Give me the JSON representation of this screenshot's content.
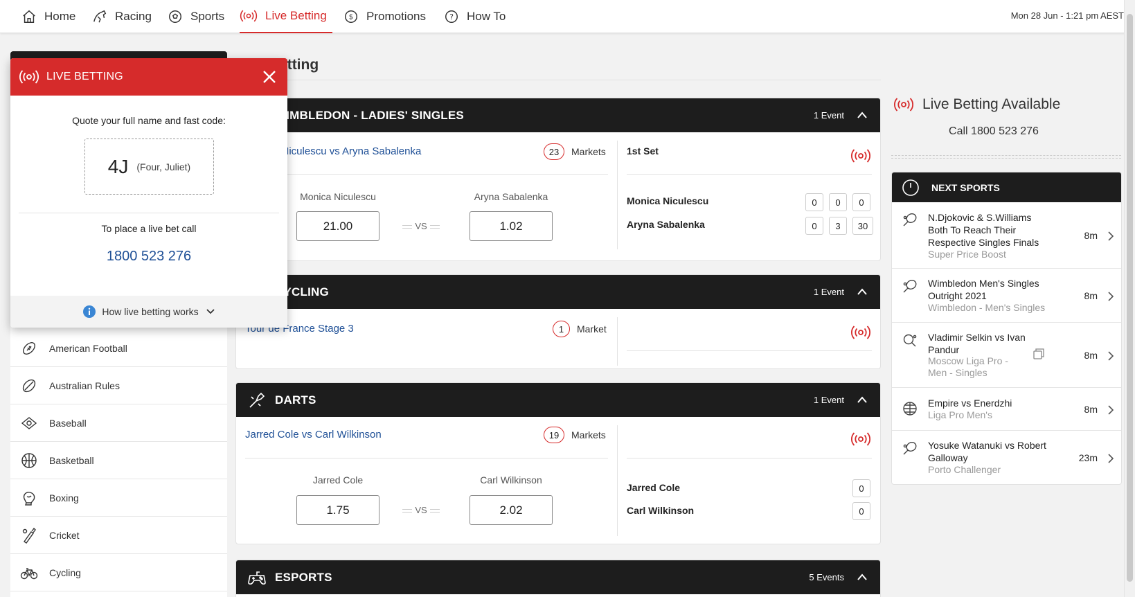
{
  "nav": {
    "items": [
      {
        "label": "Home",
        "icon": "home-icon"
      },
      {
        "label": "Racing",
        "icon": "horse-icon"
      },
      {
        "label": "Sports",
        "icon": "soccer-ball-icon"
      },
      {
        "label": "Live Betting",
        "icon": "live-signal-icon",
        "active": true
      },
      {
        "label": "Promotions",
        "icon": "dollar-coin-icon"
      },
      {
        "label": "How To",
        "icon": "help-icon"
      }
    ],
    "datetime": "Mon 28 Jun - 1:21 pm AEST"
  },
  "colors": {
    "brand_red": "#d62b2b",
    "header_dark": "#1d1d1d",
    "link_blue": "#1e4f96"
  },
  "sidebar": {
    "sports": [
      {
        "label": "American Football",
        "icon": "american-football-icon"
      },
      {
        "label": "Australian Rules",
        "icon": "australian-rules-icon"
      },
      {
        "label": "Baseball",
        "icon": "baseball-icon"
      },
      {
        "label": "Basketball",
        "icon": "basketball-icon"
      },
      {
        "label": "Boxing",
        "icon": "boxing-glove-icon"
      },
      {
        "label": "Cricket",
        "icon": "cricket-icon"
      },
      {
        "label": "Cycling",
        "icon": "bicycle-icon"
      }
    ]
  },
  "main": {
    "page_title": "Live Betting",
    "sections": [
      {
        "title": "WIMBLEDON - LADIES' SINGLES",
        "count": "1 Event",
        "event": {
          "name": "Monica Niculescu vs Aryna Sabalenka",
          "markets_count": "23",
          "markets_label": "Markets",
          "home": {
            "name": "Monica Niculescu",
            "odds": "21.00"
          },
          "away": {
            "name": "Aryna Sabalenka",
            "odds": "1.02"
          },
          "vs": "VS",
          "set_label": "1st Set",
          "scoreboard": [
            {
              "name": "Monica Niculescu",
              "scores": [
                "0",
                "0",
                "0"
              ]
            },
            {
              "name": "Aryna Sabalenka",
              "scores": [
                "0",
                "3",
                "30"
              ]
            }
          ]
        }
      },
      {
        "title": "CYCLING",
        "count": "1 Event",
        "event": {
          "name": "Tour de France Stage 3",
          "markets_count": "1",
          "markets_label": "Market"
        }
      },
      {
        "title": "DARTS",
        "count": "1 Event",
        "event": {
          "name": "Jarred Cole vs Carl Wilkinson",
          "markets_count": "19",
          "markets_label": "Markets",
          "home": {
            "name": "Jarred Cole",
            "odds": "1.75"
          },
          "away": {
            "name": "Carl Wilkinson",
            "odds": "2.02"
          },
          "vs": "VS",
          "scoreboard": [
            {
              "name": "Jarred Cole",
              "scores": [
                "0"
              ]
            },
            {
              "name": "Carl Wilkinson",
              "scores": [
                "0"
              ]
            }
          ]
        }
      },
      {
        "title": "ESPORTS",
        "count": "5 Events"
      }
    ]
  },
  "popup": {
    "title": "LIVE BETTING",
    "quote": "Quote your full name and fast code:",
    "code": "4J",
    "code_phonetic": "(Four, Juliet)",
    "place_call": "To place a live bet call",
    "phone": "1800 523 276",
    "how_works": "How live betting works"
  },
  "right": {
    "title": "Live Betting Available",
    "phone_line": "Call 1800 523 276",
    "next_title": "NEXT SPORTS",
    "next": [
      {
        "name": "N.Djokovic & S.Williams Both To Reach Their Respective Singles Finals",
        "sub": "Super Price Boost",
        "time": "8m",
        "icon": "tennis-racket-icon"
      },
      {
        "name": "Wimbledon Men's Singles Outright 2021",
        "sub": "Wimbledon - Men's Singles",
        "time": "8m",
        "icon": "tennis-racket-icon"
      },
      {
        "name": "Vladimir Selkin vs Ivan Pandur",
        "sub": "Moscow Liga Pro - Men - Singles",
        "time": "8m",
        "icon": "table-tennis-icon"
      },
      {
        "name": "Empire vs Enerdzhi",
        "sub": "Liga Pro Men's",
        "time": "8m",
        "icon": "volleyball-icon"
      },
      {
        "name": "Yosuke Watanuki vs Robert Galloway",
        "sub": "Porto Challenger",
        "time": "23m",
        "icon": "tennis-racket-icon"
      }
    ]
  }
}
